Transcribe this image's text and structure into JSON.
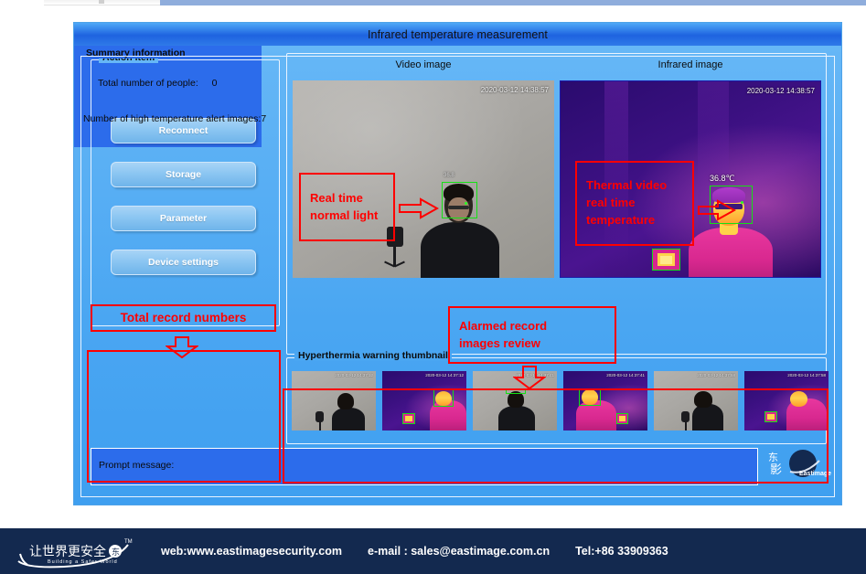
{
  "window": {
    "title": "Infrared temperature measurement"
  },
  "action_panel": {
    "legend": "Action item",
    "buttons": [
      {
        "label": "Reconnect",
        "name": "reconnect-button"
      },
      {
        "label": "Storage",
        "name": "storage-button"
      },
      {
        "label": "Parameter",
        "name": "parameter-button"
      },
      {
        "label": "Device settings",
        "name": "device-settings-button"
      }
    ]
  },
  "summary_panel": {
    "legend": "Summary information",
    "total_people_label": "Total number of people:",
    "total_people_value": "0",
    "alert_images_line": "Number of high temperature alert images:7"
  },
  "video_panel": {
    "video_caption": "Video image",
    "infrared_caption": "Infrared image",
    "video_timestamp": "2020-03-12 14:38:57",
    "infrared_timestamp": "2020-03-12 14:38:57",
    "face_temperature": "36.8℃",
    "video_face_label": "36.8"
  },
  "thumbnails": {
    "legend": "Hyperthermia warning thumbnail",
    "items": [
      {
        "kind": "visible",
        "timestamp": "2020-03-12 14:37:12"
      },
      {
        "kind": "thermal",
        "timestamp": "2020-03-12 14:37:12"
      },
      {
        "kind": "visible",
        "timestamp": "2020-03-12 14:37:41"
      },
      {
        "kind": "thermal",
        "timestamp": "2020-03-12 14:37:41"
      },
      {
        "kind": "visible",
        "timestamp": "2020-03-12 14:37:58"
      },
      {
        "kind": "thermal",
        "timestamp": "2020-03-12 14:37:58"
      }
    ]
  },
  "prompt": {
    "label": "Prompt message:",
    "value": ""
  },
  "annotations": {
    "normal_light": {
      "line1": "Real time",
      "line2": "normal light"
    },
    "thermal": {
      "line1": "Thermal video",
      "line2": "real time",
      "line3": "temperature"
    },
    "record_numbers": "Total record numbers",
    "alarmed_review": {
      "line1": "Alarmed record",
      "line2": "images review"
    }
  },
  "branding": {
    "app_logo_text": "Eastimage",
    "app_logo_cn": "东影",
    "footer_logo_cn": "让世界更安全",
    "footer_logo_en": "Building a Safer World",
    "footer_tm": "TM"
  },
  "footer": {
    "web": "web:www.eastimagesecurity.com",
    "email": "e-mail : sales@eastimage.com.cn",
    "tel": "Tel:+86 33909363"
  },
  "colors": {
    "title_blue": "#1e63e0",
    "app_blue": "#4aa6f2",
    "panel_blue": "#2c6ceb",
    "annotation_red": "#ff0000",
    "footer_navy": "#13294f",
    "detect_green": "#15e015"
  }
}
